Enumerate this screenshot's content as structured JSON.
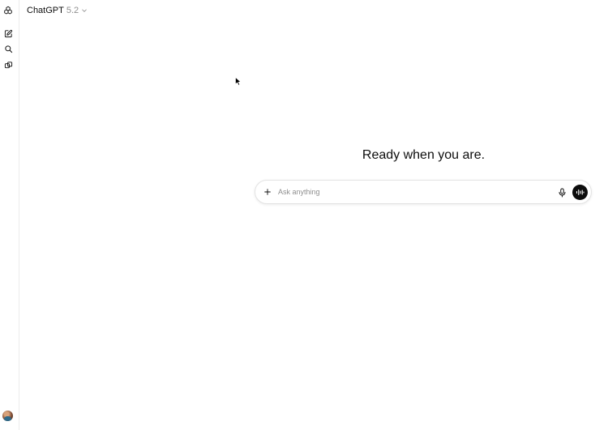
{
  "header": {
    "model_name": "ChatGPT",
    "model_version": "5.2"
  },
  "sidebar": {
    "items": [
      {
        "icon": "openai-logo-icon"
      },
      {
        "icon": "new-chat-icon"
      },
      {
        "icon": "search-icon"
      },
      {
        "icon": "library-icon"
      }
    ],
    "account": {
      "icon": "avatar"
    }
  },
  "main": {
    "headline": "Ready when you are.",
    "composer": {
      "placeholder": "Ask anything",
      "value": ""
    }
  },
  "colors": {
    "text": "#0d0d0d",
    "muted": "#8f8f8f",
    "voice_button": "#0d0d0d",
    "border": "#e3e3e3"
  }
}
